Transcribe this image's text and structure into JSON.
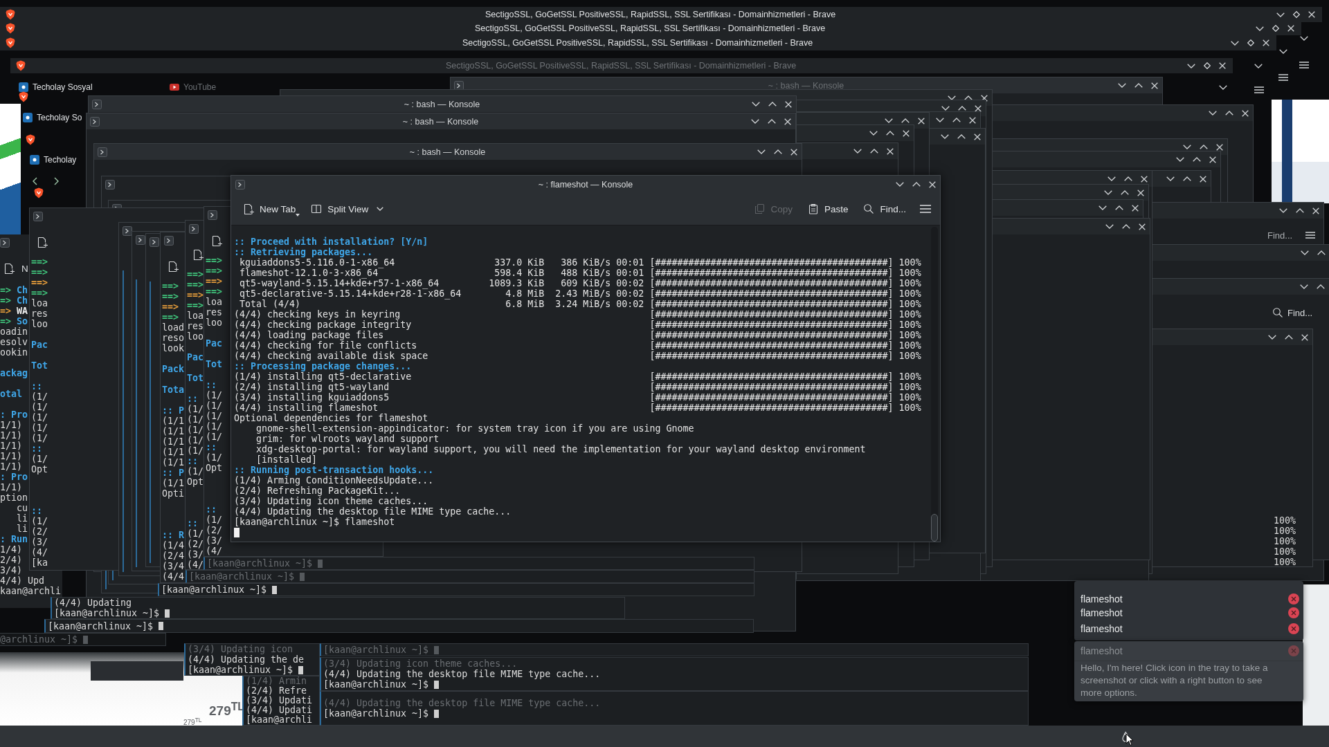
{
  "browser_windows": [
    {
      "title": "SectigoSSL, GoGetSSL PositiveSSL, RapidSSL, SSL Sertifikası - Domainhizmetleri - Brave",
      "faded": false
    },
    {
      "title": "SectigoSSL, GoGetSSL PositiveSSL, RapidSSL, SSL Sertifikası - Domainhizmetleri - Brave",
      "faded": false
    },
    {
      "title": "SectigoSSL, GoGetSSL PositiveSSL, RapidSSL, SSL Sertifikası - Domainhizmetleri - Brave",
      "faded": false
    },
    {
      "title": "SectigoSSL, GoGetSSL PositiveSSL, RapidSSL, SSL Sertifikası - Domainhizmetleri - Brave",
      "faded": true
    }
  ],
  "browser_tabs": [
    {
      "label": "Techolay Sosyal",
      "kind": "social",
      "faded": false
    },
    {
      "label": "YouTube",
      "kind": "video",
      "faded": true
    },
    {
      "label": "Techolay So",
      "kind": "social",
      "faded": false
    },
    {
      "label": "Techolay",
      "kind": "social",
      "faded": false
    }
  ],
  "bash_windows": [
    {
      "title": "~ : bash — Konsole",
      "faded": true
    },
    {
      "title": "~ : bash — Konsole",
      "faded": false
    },
    {
      "title": "~ : bash — Konsole",
      "faded": false
    },
    {
      "title": "~ : bash — Konsole",
      "faded": false
    }
  ],
  "konsole": {
    "title": "~ : flameshot — Konsole",
    "toolbar": [
      {
        "label": "New Tab",
        "kind": "new-tab",
        "disabled": false
      },
      {
        "label": "Split View",
        "kind": "split",
        "disabled": false
      },
      {
        "label": "Copy",
        "kind": "copy",
        "disabled": true
      },
      {
        "label": "Paste",
        "kind": "paste",
        "disabled": false
      },
      {
        "label": "Find...",
        "kind": "find",
        "disabled": false
      }
    ],
    "lines": [
      {
        "kind": "header",
        "text": ":: Proceed with installation? [Y/n]"
      },
      {
        "kind": "header",
        "text": ":: Retrieving packages..."
      },
      {
        "kind": "package",
        "text": "kguiaddons5-5.116.0-1-x86_64",
        "size": "337.0 KiB",
        "speed": "386 KiB/s",
        "time": "00:01",
        "bar": "[##########################################]",
        "percent": "100%"
      },
      {
        "kind": "package",
        "text": "flameshot-12.1.0-3-x86_64",
        "size": "598.4 KiB",
        "speed": "488 KiB/s",
        "time": "00:01",
        "bar": "[##########################################]",
        "percent": "100%"
      },
      {
        "kind": "package",
        "text": "qt5-wayland-5.15.14+kde+r57-1-x86_64",
        "size": "1089.3 KiB",
        "speed": "609 KiB/s",
        "time": "00:02",
        "bar": "[##########################################]",
        "percent": "100%"
      },
      {
        "kind": "package",
        "text": "qt5-declarative-5.15.14+kde+r28-1-x86_64",
        "size": "4.8 MiB",
        "speed": "2.43 MiB/s",
        "time": "00:02",
        "bar": "[##########################################]",
        "percent": "100%"
      },
      {
        "kind": "package",
        "text": "Total (4/4)",
        "size": "6.8 MiB",
        "speed": "3.24 MiB/s",
        "time": "00:02",
        "bar": "[##########################################]",
        "percent": "100%"
      },
      {
        "kind": "step",
        "text": "(4/4) checking keys in keyring",
        "bar": "[##########################################]",
        "percent": "100%"
      },
      {
        "kind": "step",
        "text": "(4/4) checking package integrity",
        "bar": "[##########################################]",
        "percent": "100%"
      },
      {
        "kind": "step",
        "text": "(4/4) loading package files",
        "bar": "[##########################################]",
        "percent": "100%"
      },
      {
        "kind": "step",
        "text": "(4/4) checking for file conflicts",
        "bar": "[##########################################]",
        "percent": "100%"
      },
      {
        "kind": "step",
        "text": "(4/4) checking available disk space",
        "bar": "[##########################################]",
        "percent": "100%"
      },
      {
        "kind": "header",
        "text": ":: Processing package changes..."
      },
      {
        "kind": "step",
        "text": "(1/4) installing qt5-declarative",
        "bar": "[##########################################]",
        "percent": "100%"
      },
      {
        "kind": "step",
        "text": "(2/4) installing qt5-wayland",
        "bar": "[##########################################]",
        "percent": "100%"
      },
      {
        "kind": "step",
        "text": "(3/4) installing kguiaddons5",
        "bar": "[##########################################]",
        "percent": "100%"
      },
      {
        "kind": "step",
        "text": "(4/4) installing flameshot",
        "bar": "[##########################################]",
        "percent": "100%"
      },
      {
        "kind": "plain",
        "text": "Optional dependencies for flameshot"
      },
      {
        "kind": "indented",
        "text": "gnome-shell-extension-appindicator: for system tray icon if you are using Gnome"
      },
      {
        "kind": "indented",
        "text": "grim: for wlroots wayland support"
      },
      {
        "kind": "indented",
        "text": "xdg-desktop-portal: for wayland support, you will need the implementation for your wayland desktop environment"
      },
      {
        "kind": "indented",
        "text": "[installed]"
      },
      {
        "kind": "header",
        "text": ":: Running post-transaction hooks..."
      },
      {
        "kind": "plain",
        "text": "(1/4) Arming ConditionNeedsUpdate..."
      },
      {
        "kind": "plain",
        "text": "(2/4) Refreshing PackageKit..."
      },
      {
        "kind": "plain",
        "text": "(3/4) Updating icon theme caches..."
      },
      {
        "kind": "plain",
        "text": "(4/4) Updating the desktop file MIME type cache..."
      },
      {
        "kind": "prompt",
        "text": "[kaan@archlinux ~]$ flameshot"
      }
    ]
  },
  "left_terminal": {
    "toolbar_label": "N",
    "lines": [
      {
        "kind": "arrow",
        "marker": "=>",
        "text": "Ch"
      },
      {
        "kind": "arrow",
        "marker": "=>",
        "text": "Ch"
      },
      {
        "kind": "warning",
        "marker": "=>",
        "text": "WA"
      },
      {
        "kind": "arrow",
        "marker": "=>",
        "text": "So"
      },
      {
        "kind": "plain",
        "text": "oadin"
      },
      {
        "kind": "plain",
        "text": "esolv"
      },
      {
        "kind": "plain",
        "text": "ookin"
      },
      {
        "kind": "header",
        "text": "ackag"
      },
      {
        "kind": "header",
        "text": "otal"
      },
      {
        "kind": "header",
        "text": ": Pro"
      },
      {
        "kind": "plain",
        "text": "1/1)"
      },
      {
        "kind": "plain",
        "text": "1/1)"
      },
      {
        "kind": "plain",
        "text": "1/1)"
      },
      {
        "kind": "plain",
        "text": "1/1)"
      },
      {
        "kind": "plain",
        "text": "1/1)"
      },
      {
        "kind": "header",
        "text": ": Pro"
      },
      {
        "kind": "plain",
        "text": "1/1)"
      },
      {
        "kind": "plain",
        "text": "ption"
      },
      {
        "kind": "indented",
        "text": "cu"
      },
      {
        "kind": "indented",
        "text": "li"
      },
      {
        "kind": "indented",
        "text": "li"
      },
      {
        "kind": "header",
        "text": ": Run"
      },
      {
        "kind": "plain",
        "text": "1/4)"
      },
      {
        "kind": "plain",
        "text": "2/4)"
      },
      {
        "kind": "plain",
        "text": "3/4)"
      },
      {
        "kind": "plain",
        "text": "4/4) Upd"
      },
      {
        "kind": "plain",
        "text": "kaan@archli"
      }
    ]
  },
  "trail_windows": [
    {
      "lines": [
        {
          "kind": "arrow",
          "text": "==>"
        },
        {
          "kind": "arrow",
          "text": "==>"
        },
        {
          "kind": "warning",
          "text": "==>"
        },
        {
          "kind": "arrow",
          "text": "==>"
        },
        {
          "kind": "plain",
          "text": "loa"
        },
        {
          "kind": "plain",
          "text": "res"
        },
        {
          "kind": "plain",
          "text": "loo"
        },
        {
          "kind": "header",
          "text": "Pac"
        },
        {
          "kind": "header",
          "text": "Tot"
        },
        {
          "kind": "header",
          "text": "::"
        },
        {
          "kind": "plain",
          "text": "(1/"
        },
        {
          "kind": "plain",
          "text": "(1/"
        },
        {
          "kind": "plain",
          "text": "(1/"
        },
        {
          "kind": "plain",
          "text": "(1/"
        },
        {
          "kind": "plain",
          "text": "(1/"
        },
        {
          "kind": "header",
          "text": "::"
        },
        {
          "kind": "plain",
          "text": "(1/"
        },
        {
          "kind": "plain",
          "text": "Opt"
        },
        {
          "kind": "header",
          "text": "::"
        },
        {
          "kind": "plain",
          "text": "(1/"
        },
        {
          "kind": "plain",
          "text": "(2/"
        },
        {
          "kind": "plain",
          "text": "(3/"
        },
        {
          "kind": "plain",
          "text": "(4/"
        },
        {
          "kind": "plain",
          "text": "[ka"
        }
      ]
    },
    {
      "lines": [
        {
          "kind": "arrow",
          "text": "==>"
        },
        {
          "kind": "arrow",
          "text": "==>"
        },
        {
          "kind": "warning",
          "text": "==>"
        },
        {
          "kind": "arrow",
          "text": "==>"
        },
        {
          "kind": "plain",
          "text": "load"
        },
        {
          "kind": "plain",
          "text": "reso"
        },
        {
          "kind": "plain",
          "text": "look"
        },
        {
          "kind": "header",
          "text": "Pack"
        },
        {
          "kind": "header",
          "text": "Tota"
        },
        {
          "kind": "header",
          "text": ":: P"
        },
        {
          "kind": "plain",
          "text": "(1/1"
        },
        {
          "kind": "plain",
          "text": "(1/1"
        },
        {
          "kind": "plain",
          "text": "(1/1"
        },
        {
          "kind": "plain",
          "text": "(1/1"
        },
        {
          "kind": "plain",
          "text": "(1/1"
        },
        {
          "kind": "header",
          "text": ":: P"
        },
        {
          "kind": "plain",
          "text": "(1/1"
        },
        {
          "kind": "plain",
          "text": "Opti"
        },
        {
          "kind": "header",
          "text": ":: R"
        },
        {
          "kind": "plain",
          "text": "(1/4"
        },
        {
          "kind": "plain",
          "text": "(2/4"
        },
        {
          "kind": "plain",
          "text": "(3/4"
        },
        {
          "kind": "plain",
          "text": "(4/4"
        }
      ]
    },
    {
      "lines": [
        {
          "kind": "arrow",
          "text": "==>"
        },
        {
          "kind": "arrow",
          "text": "==>"
        },
        {
          "kind": "warning",
          "text": "==>"
        },
        {
          "kind": "arrow",
          "text": "==>"
        },
        {
          "kind": "plain",
          "text": "loa"
        },
        {
          "kind": "plain",
          "text": "res"
        },
        {
          "kind": "plain",
          "text": "loo"
        },
        {
          "kind": "header",
          "text": "Pac"
        },
        {
          "kind": "header",
          "text": "Tot"
        },
        {
          "kind": "header",
          "text": "::"
        },
        {
          "kind": "plain",
          "text": "(1/"
        },
        {
          "kind": "plain",
          "text": "(1/"
        },
        {
          "kind": "plain",
          "text": "(1/"
        },
        {
          "kind": "plain",
          "text": "(1/"
        },
        {
          "kind": "plain",
          "text": "(1/"
        },
        {
          "kind": "header",
          "text": "::"
        },
        {
          "kind": "plain",
          "text": "(1/"
        },
        {
          "kind": "plain",
          "text": "Opt"
        },
        {
          "kind": "header",
          "text": "::"
        },
        {
          "kind": "plain",
          "text": "(1/"
        },
        {
          "kind": "plain",
          "text": "(2/"
        },
        {
          "kind": "plain",
          "text": "(3/"
        },
        {
          "kind": "plain",
          "text": "(4/"
        }
      ]
    },
    {
      "lines": [
        {
          "kind": "arrow",
          "text": "==>"
        },
        {
          "kind": "arrow",
          "text": "==>"
        },
        {
          "kind": "warning",
          "text": "==>"
        },
        {
          "kind": "arrow",
          "text": "==>"
        },
        {
          "kind": "plain",
          "text": "loa"
        },
        {
          "kind": "plain",
          "text": "res"
        },
        {
          "kind": "plain",
          "text": "loo"
        },
        {
          "kind": "header",
          "text": "Pac"
        },
        {
          "kind": "header",
          "text": "Tot"
        },
        {
          "kind": "header",
          "text": "::"
        },
        {
          "kind": "plain",
          "text": "(1/"
        },
        {
          "kind": "plain",
          "text": "(1/"
        },
        {
          "kind": "plain",
          "text": "(1/"
        },
        {
          "kind": "plain",
          "text": "(1/"
        },
        {
          "kind": "plain",
          "text": "(1/"
        },
        {
          "kind": "header",
          "text": "::"
        },
        {
          "kind": "plain",
          "text": "(1/"
        },
        {
          "kind": "plain",
          "text": "Opt"
        },
        {
          "kind": "header",
          "text": "::"
        },
        {
          "kind": "plain",
          "text": "(1/"
        },
        {
          "kind": "plain",
          "text": "(2/"
        },
        {
          "kind": "plain",
          "text": "(3/"
        },
        {
          "kind": "plain",
          "text": "(4/"
        }
      ]
    }
  ],
  "trail_terminals": [
    {
      "lines": [
        {
          "kind": "prompt",
          "text": "[kaan@archlinux ~]$",
          "faded": true
        }
      ]
    },
    {
      "lines": [
        {
          "kind": "prompt",
          "text": "[kaan@archlinux ~]$",
          "faded": true
        }
      ]
    },
    {
      "lines": [
        {
          "kind": "prompt",
          "text": "[kaan@archlinux ~]$",
          "faded": false
        }
      ]
    },
    {
      "lines": [
        {
          "kind": "output",
          "text": "(4/4) Updating",
          "faded": false
        },
        {
          "kind": "prompt",
          "text": "[kaan@archlinux ~]$",
          "faded": false
        }
      ]
    },
    {
      "lines": [
        {
          "kind": "prompt",
          "text": "[kaan@archlinux ~]$",
          "faded": false
        }
      ]
    },
    {
      "lines": [
        {
          "kind": "prompt",
          "text": "@archlinux ~]$",
          "faded": true
        }
      ]
    },
    {
      "lines": [
        {
          "kind": "output",
          "text": "(3/4) Updating icon",
          "faded": true
        },
        {
          "kind": "output",
          "text": "(4/4) Updating the de",
          "faded": false
        },
        {
          "kind": "prompt",
          "text": "[kaan@archlinux ~]$",
          "faded": false
        }
      ]
    },
    {
      "lines": [
        {
          "kind": "output",
          "text": "(1/4) Armin",
          "faded": true
        },
        {
          "kind": "output",
          "text": "(2/4) Refre",
          "faded": false
        },
        {
          "kind": "output",
          "text": "(3/4) Updati",
          "faded": false
        },
        {
          "kind": "output",
          "text": "(4/4) Updati",
          "faded": false
        },
        {
          "kind": "output",
          "text": "[kaan@archli",
          "faded": false
        }
      ]
    },
    {
      "lines": [
        {
          "kind": "prompt",
          "text": "[kaan@archlinux ~]$",
          "faded": true
        }
      ]
    },
    {
      "lines": [
        {
          "kind": "output",
          "text": "(3/4) Updating icon theme caches...",
          "faded": true
        },
        {
          "kind": "output",
          "text": "(4/4) Updating the desktop file MIME type cache...",
          "faded": false
        },
        {
          "kind": "prompt",
          "text": "[kaan@archlinux ~]$",
          "faded": false
        }
      ]
    },
    {
      "lines": [
        {
          "kind": "output",
          "text": "(4/4) Updating the desktop file MIME type cache...",
          "faded": true
        },
        {
          "kind": "prompt",
          "text": "[kaan@archlinux ~]$",
          "faded": false
        }
      ]
    }
  ],
  "right_fragments": {
    "find_labels": [
      "Find...",
      "Find..."
    ],
    "percents": [
      "100%",
      "100%",
      "100%",
      "100%",
      "100%"
    ]
  },
  "webpage_fragment": {
    "prices": [
      "279$^{TL}$",
      "279$^{TL}$"
    ]
  },
  "notifications": {
    "stack": [
      {
        "app": "flameshot"
      },
      {
        "app": "flameshot"
      },
      {
        "app": "flameshot"
      }
    ],
    "popup": {
      "app": "flameshot",
      "body": "Hello, I'm here! Click icon in the tray to take a screenshot or click with a right button to see more options."
    }
  }
}
